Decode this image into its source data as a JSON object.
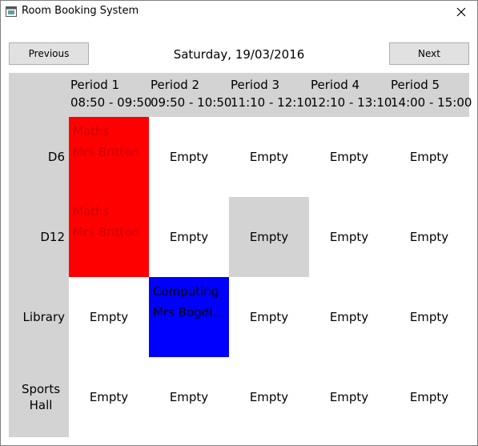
{
  "window": {
    "title": "Room Booking System"
  },
  "nav": {
    "previous_label": "Previous",
    "next_label": "Next",
    "date": "Saturday, 19/03/2016"
  },
  "periods": [
    {
      "label": "Period 1",
      "time": "08:50 - 09:50"
    },
    {
      "label": "Period 2",
      "time": "09:50 - 10:50"
    },
    {
      "label": "Period 3",
      "time": "11:10 - 12:10"
    },
    {
      "label": "Period 4",
      "time": "12:10 - 13:10"
    },
    {
      "label": "Period 5",
      "time": "14:00 - 15:00"
    }
  ],
  "rooms": [
    {
      "name": "D6",
      "cells": [
        {
          "subject": "Maths",
          "teacher": "Mrs Britton",
          "bg": "#ff0000",
          "fg": "#cc0000"
        },
        {
          "text": "Empty",
          "bg": "#ffffff"
        },
        {
          "text": "Empty",
          "bg": "#ffffff"
        },
        {
          "text": "Empty",
          "bg": "#ffffff"
        },
        {
          "text": "Empty",
          "bg": "#ffffff"
        }
      ]
    },
    {
      "name": "D12",
      "cells": [
        {
          "subject": "Maths",
          "teacher": "Mrs Britton",
          "bg": "#ff0000",
          "fg": "#cc0000"
        },
        {
          "text": "Empty",
          "bg": "#ffffff"
        },
        {
          "text": "Empty",
          "bg": "#d3d3d3"
        },
        {
          "text": "Empty",
          "bg": "#ffffff"
        },
        {
          "text": "Empty",
          "bg": "#ffffff"
        }
      ]
    },
    {
      "name": "Library",
      "cells": [
        {
          "text": "Empty",
          "bg": "#ffffff"
        },
        {
          "subject": "Computing",
          "teacher": "Mrs Bogdi...",
          "bg": "#0000ff",
          "fg": "#000000"
        },
        {
          "text": "Empty",
          "bg": "#ffffff"
        },
        {
          "text": "Empty",
          "bg": "#ffffff"
        },
        {
          "text": "Empty",
          "bg": "#ffffff"
        }
      ]
    },
    {
      "name": "Sports Hall",
      "cells": [
        {
          "text": "Empty",
          "bg": "#ffffff"
        },
        {
          "text": "Empty",
          "bg": "#ffffff"
        },
        {
          "text": "Empty",
          "bg": "#ffffff"
        },
        {
          "text": "Empty",
          "bg": "#ffffff"
        },
        {
          "text": "Empty",
          "bg": "#ffffff"
        }
      ]
    }
  ],
  "icons": {
    "app": "app-window-icon",
    "close": "close-icon"
  }
}
